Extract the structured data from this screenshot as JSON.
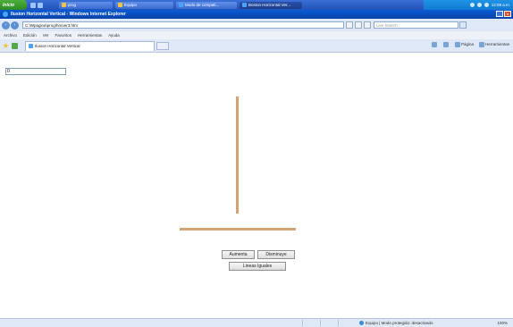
{
  "taskbar": {
    "start_label": "Inicio",
    "tasks": [
      {
        "label": "prog"
      },
      {
        "label": "Equipo"
      },
      {
        "label": "Modo de compati..."
      },
      {
        "label": "Boston Horizontal Ver..."
      }
    ],
    "clock": "12:08 a.m."
  },
  "window": {
    "title": "Ilusion Horizontal Vertical - Windows Internet Explorer",
    "address": "C:\\Wpagina\\prog\\horver3.htm",
    "search_placeholder": "Live Search"
  },
  "menu": {
    "items": [
      "Archivo",
      "Edición",
      "Ver",
      "Favoritos",
      "Herramientas",
      "Ayuda"
    ]
  },
  "tab": {
    "label": "Ilusion Horizontal Vertical"
  },
  "commands": {
    "page": "Página",
    "tools": "Herramientas"
  },
  "content": {
    "input_value": "0",
    "buttons": {
      "increase": "Aumenta",
      "decrease": "Disminuye",
      "equal": "Lineas Iguales"
    },
    "line_color": "#d4a373"
  },
  "status": {
    "zone": "Equipo | Modo protegido: desactivado",
    "zoom": "100%"
  }
}
